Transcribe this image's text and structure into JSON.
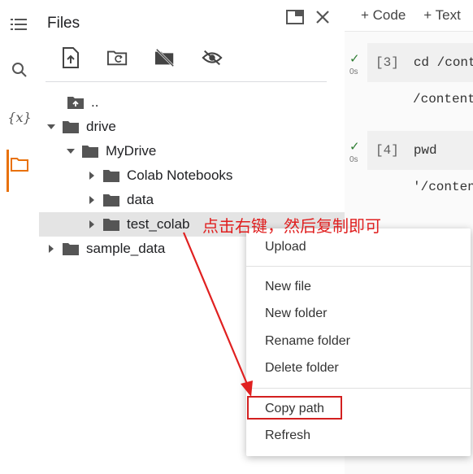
{
  "panel": {
    "title": "Files"
  },
  "tree": [
    {
      "label": "..",
      "indent": 0
    },
    {
      "label": "drive",
      "indent": 0
    },
    {
      "label": "MyDrive",
      "indent": 1
    },
    {
      "label": "Colab Notebooks",
      "indent": 2
    },
    {
      "label": "data",
      "indent": 2
    },
    {
      "label": "test_colab",
      "indent": 2
    },
    {
      "label": "sample_data",
      "indent": 0
    }
  ],
  "notebook": {
    "add_code": "+ Code",
    "add_text": "+ Text",
    "cells": [
      {
        "number": "[3]",
        "code": "cd /content",
        "output": "/content",
        "time": "0s"
      },
      {
        "number": "[4]",
        "code": "pwd",
        "output": "'/content",
        "time": "0s"
      }
    ]
  },
  "context_menu": {
    "items": [
      "Upload",
      "New file",
      "New folder",
      "Rename folder",
      "Delete folder",
      "Copy path",
      "Refresh"
    ]
  },
  "annotation": {
    "text": "点击右键，然后复制即可",
    "color": "#e02020"
  },
  "colors": {
    "accent": "#e8710a",
    "selected_row": "#e4e4e4",
    "check": "#2e7d32"
  }
}
